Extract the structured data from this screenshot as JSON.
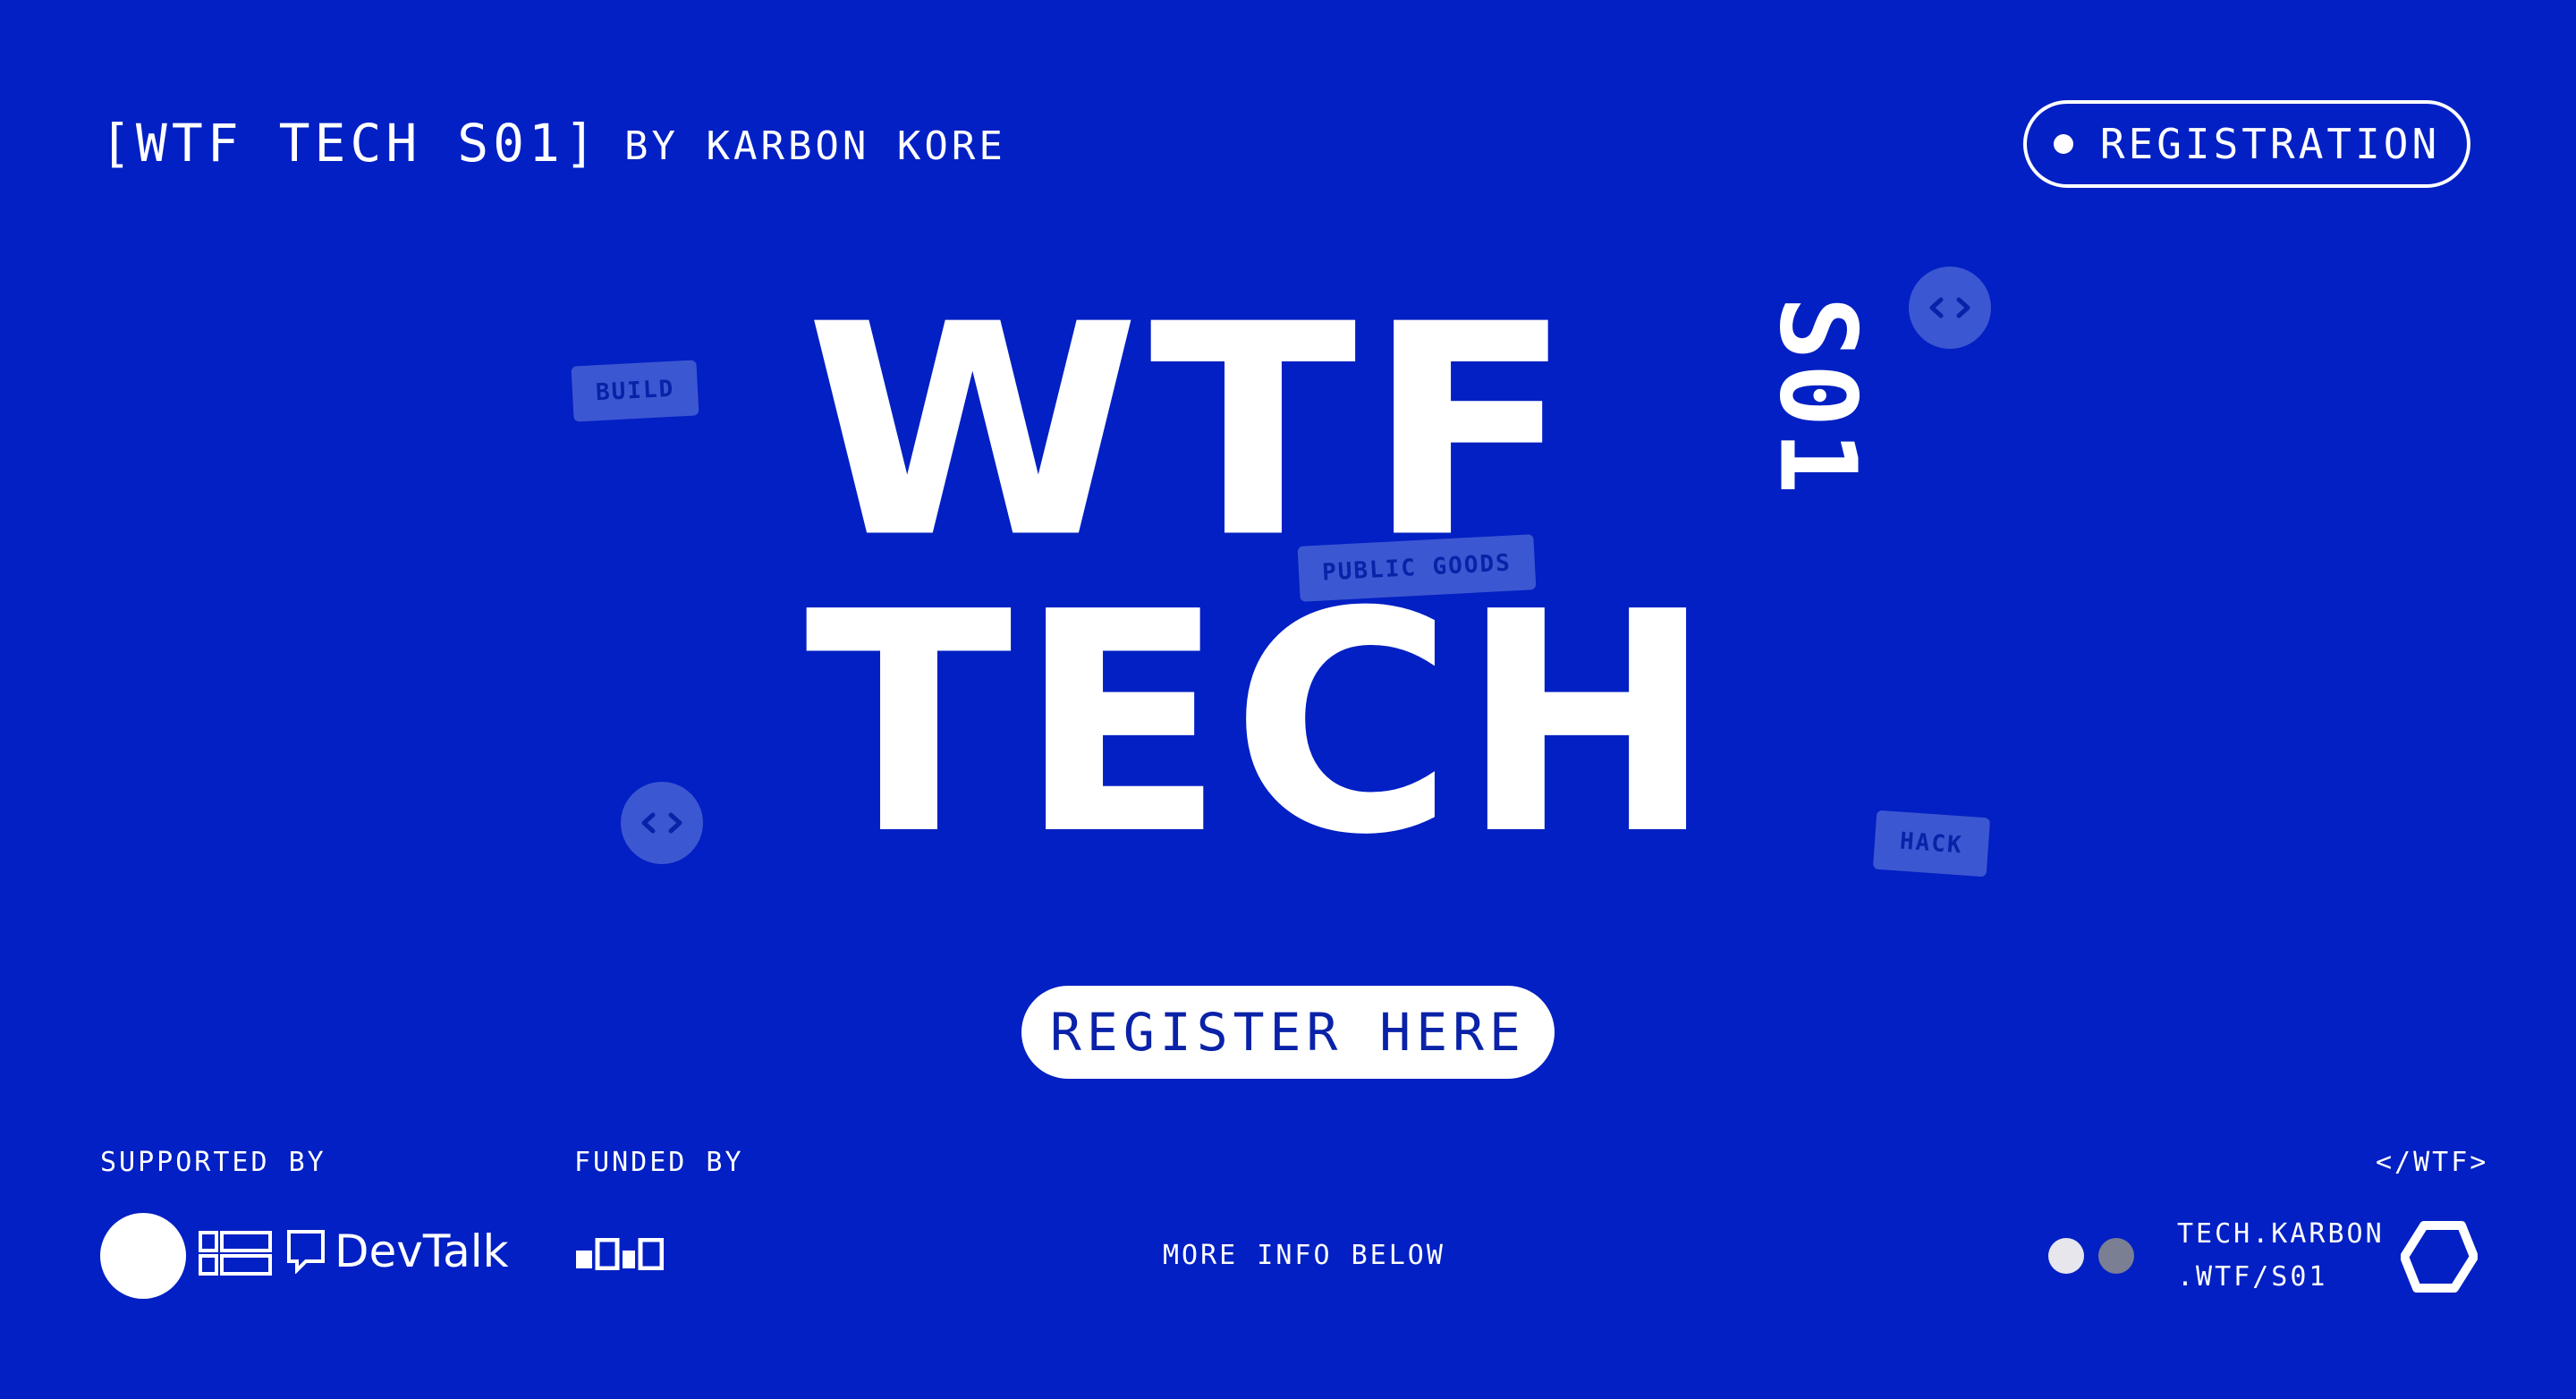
{
  "header": {
    "event_code": "[WTF TECH S01]",
    "byline": "BY KARBON KORE",
    "registration_label": "REGISTRATION"
  },
  "hero": {
    "line1": "WTF",
    "line2": "TECH",
    "season": "S01",
    "tags": [
      "BUILD",
      "PUBLIC GOODS",
      "HACK"
    ],
    "code_icon": "</>"
  },
  "cta": {
    "register_label": "REGISTER HERE"
  },
  "footer": {
    "supported_by": "SUPPORTED BY",
    "funded_by": "FUNDED BY",
    "sponsor_devtalk": "DevTalk",
    "more_info": "MORE INFO BELOW",
    "wtf_tag": "</WTF>",
    "karbon_line1": "TECH.KARBON",
    "karbon_line2": ".WTF/S01"
  },
  "colors": {
    "background": "#0220c3",
    "foreground": "#ffffff",
    "tag_bg": "#3c57d2",
    "tag_text": "#0a22a8"
  }
}
